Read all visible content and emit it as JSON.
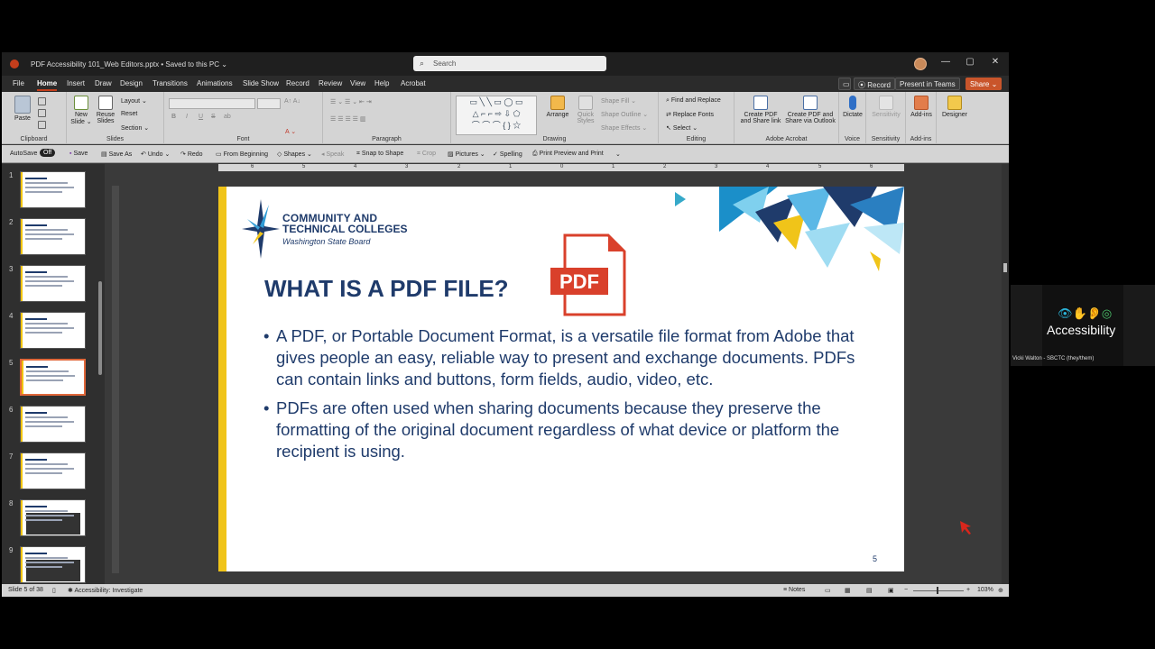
{
  "window": {
    "doc_title": "PDF Accessibility 101_Web Editors.pptx • Saved to this PC ⌄",
    "search_placeholder": "Search",
    "min": "—",
    "max": "▢",
    "close": "✕"
  },
  "menu": {
    "tabs": [
      "File",
      "Home",
      "Insert",
      "Draw",
      "Design",
      "Transitions",
      "Animations",
      "Slide Show",
      "Record",
      "Review",
      "View",
      "Help",
      "Acrobat"
    ],
    "active": "Home",
    "record": "⦿ Record",
    "present": "Present in Teams",
    "share": "Share ⌄"
  },
  "ribbon": {
    "clipboard": {
      "paste": "Paste",
      "label": "Clipboard"
    },
    "slides": {
      "new_slide": "New Slide ⌄",
      "reuse": "Reuse Slides",
      "layout": "Layout ⌄",
      "reset": "Reset",
      "section": "Section ⌄",
      "label": "Slides"
    },
    "font": {
      "label": "Font",
      "bold": "B",
      "italic": "I",
      "underline": "U",
      "strike": "S",
      "ab": "ab"
    },
    "paragraph": {
      "label": "Paragraph"
    },
    "drawing": {
      "arrange": "Arrange",
      "quick_styles": "Quick Styles",
      "shape_fill": "Shape Fill ⌄",
      "shape_outline": "Shape Outline ⌄",
      "shape_effects": "Shape Effects ⌄",
      "label": "Drawing"
    },
    "editing": {
      "find": "Find and Replace",
      "replace": "Replace Fonts",
      "select": "Select ⌄",
      "label": "Editing"
    },
    "acrobat": {
      "create1": "Create PDF and Share link",
      "create2": "Create PDF and Share via Outlook",
      "label": "Adobe Acrobat"
    },
    "voice": {
      "dictate": "Dictate",
      "label": "Voice"
    },
    "sensitivity": {
      "btn": "Sensitivity",
      "label": "Sensitivity"
    },
    "addins": {
      "btn": "Add-ins",
      "label": "Add-ins"
    },
    "designer": {
      "btn": "Designer"
    }
  },
  "qat": {
    "autosave": "AutoSave",
    "autosave_state": "Off",
    "save": "Save",
    "save_as": "Save As",
    "undo": "Undo ⌄",
    "redo": "Redo",
    "from_beginning": "From Beginning",
    "shapes": "Shapes ⌄",
    "speak": "Speak",
    "snap": "Snap to Shape",
    "crop": "Crop",
    "pictures": "Pictures ⌄",
    "spelling": "Spelling",
    "print_preview": "Print Preview and Print"
  },
  "ruler": {
    "ticks": [
      "6",
      "5",
      "4",
      "3",
      "2",
      "1",
      "0",
      "1",
      "2",
      "3",
      "4",
      "5",
      "6"
    ]
  },
  "thumbnails": {
    "numbers": [
      "1",
      "2",
      "3",
      "4",
      "5",
      "6",
      "7",
      "8",
      "9"
    ],
    "selected": 5
  },
  "slide": {
    "logo_line1": "COMMUNITY AND",
    "logo_line2": "TECHNICAL COLLEGES",
    "logo_line3": "Washington State Board",
    "title": "WHAT IS A PDF FILE?",
    "pdf_icon_text": "PDF",
    "bullets": [
      "A PDF, or Portable Document Format, is a versatile file format from Adobe that gives people an easy, reliable way to present and exchange documents. PDFs can contain links and buttons, form fields, audio, video, etc.",
      "PDFs are often used when sharing documents because they preserve the formatting of the original document regardless of what device or platform the recipient is using."
    ],
    "page_number": "5"
  },
  "status": {
    "slide_of": "Slide 5 of 38",
    "accessibility": "Accessibility: Investigate",
    "notes": "Notes",
    "zoom": "103%"
  },
  "overlay": {
    "label": "Accessibility",
    "name": "Vicki Walton - SBCTC (they/them)"
  },
  "colors": {
    "accent": "#c43e1c",
    "slide_navy": "#1f3b6b",
    "slide_yellow": "#f0c419",
    "pdf_red": "#d9402b"
  }
}
